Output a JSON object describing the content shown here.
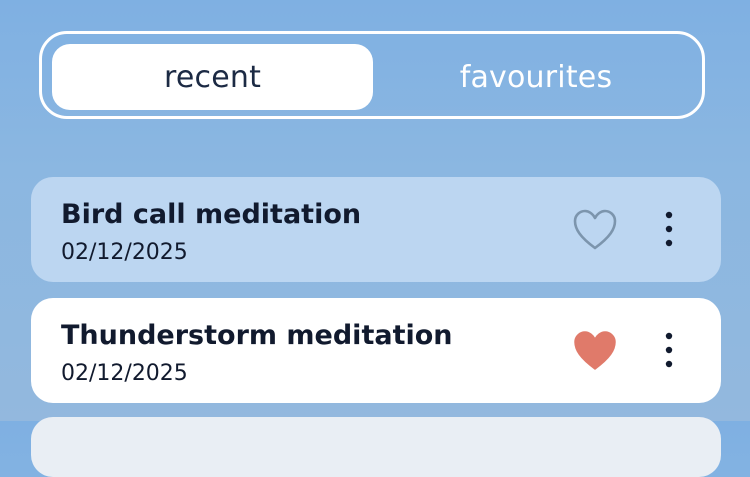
{
  "tabs": {
    "recent_label": "recent",
    "favourites_label": "favourites",
    "selected": "recent"
  },
  "items": [
    {
      "title": "Bird call meditation",
      "date": "02/12/2025",
      "favourite": false,
      "icon": "heart-outline-icon"
    },
    {
      "title": "Thunderstorm meditation",
      "date": "02/12/2025",
      "favourite": true,
      "icon": "heart-filled-icon"
    }
  ],
  "colors": {
    "heart_filled": "#e07a6a",
    "heart_outline": "#7c95ad",
    "text_dark": "#111a2e",
    "selected_card": "#bcd6f1"
  }
}
